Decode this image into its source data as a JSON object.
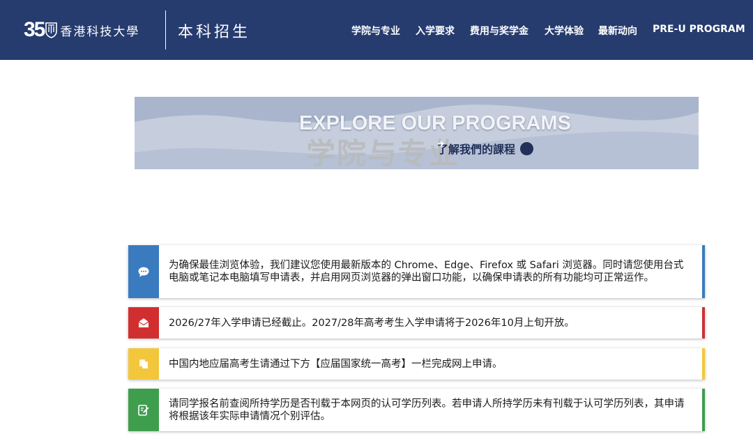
{
  "header": {
    "logo_number": "35",
    "logo_name": "香港科技大學",
    "site_title": "本科招生",
    "nav": [
      {
        "label": "学院与专业"
      },
      {
        "label": "入学要求"
      },
      {
        "label": "费用与奖学金"
      },
      {
        "label": "大学体验"
      },
      {
        "label": "最新动向"
      },
      {
        "label": "PRE-U PROGRAM"
      }
    ]
  },
  "banner": {
    "headline": "EXPLORE OUR PROGRAMS",
    "ghost_text": "学院与专业",
    "link_text": "了解我們的課程",
    "link_icon": "arrow-right-circle-icon"
  },
  "notices": [
    {
      "icon": "chat-bubble-icon",
      "color": "#3a7bbf",
      "text": "为确保最佳浏览体验，我们建议您使用最新版本的 Chrome、Edge、Firefox 或 Safari 浏览器。同时请您使用台式电脑或笔记本电脑填写申请表，并启用网页浏览器的弹出窗口功能，以确保申请表的所有功能均可正常运作。"
    },
    {
      "icon": "envelope-open-icon",
      "color": "#d12f2f",
      "text": "2026/27年入学申请已经截止。2027/28年高考考生入学申请将于2026年10月上旬开放。"
    },
    {
      "icon": "copy-documents-icon",
      "color": "#f3c73b",
      "text": "中国内地应届高考生请通过下方【应届国家统一高考】一栏完成网上申请。"
    },
    {
      "icon": "edit-document-icon",
      "color": "#3f9e4e",
      "text": "请同学报名前查阅所持学历是否刊载于本网页的认可学历列表。若申请人所持学历未有刊载于认可学历列表，其申请将根据该年实际申请情况个别评估。"
    }
  ],
  "colors": {
    "header_bg": "#263b6e",
    "banner_bg": "#c6cede",
    "banner_link": "#22305a"
  }
}
